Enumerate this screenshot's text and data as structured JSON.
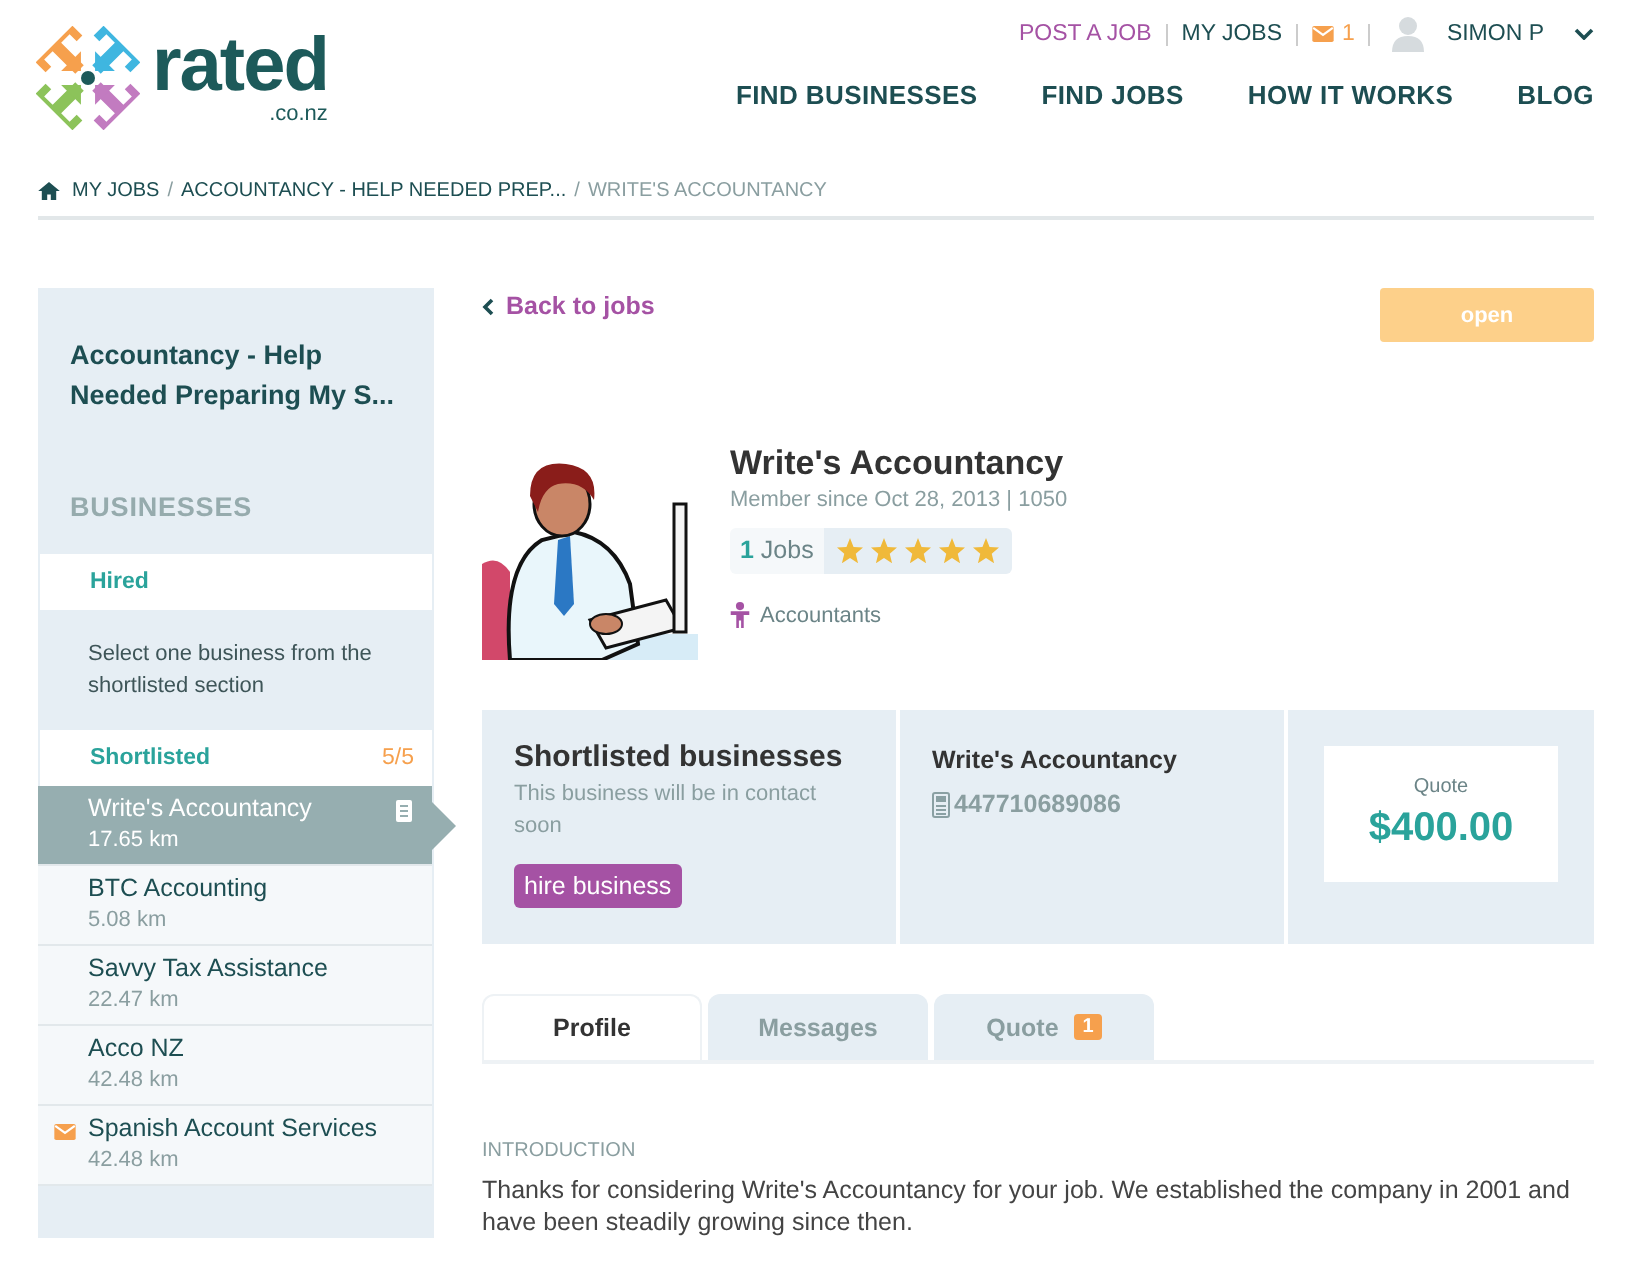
{
  "header": {
    "logo_text": "rated",
    "logo_domain": ".co.nz",
    "top_links": [
      {
        "label": "POST A JOB",
        "kind": "highlight"
      },
      {
        "label": "MY JOBS",
        "kind": "plain"
      }
    ],
    "messages_count": "1",
    "user_name": "SIMON P",
    "nav": [
      "FIND BUSINESSES",
      "FIND JOBS",
      "HOW IT WORKS",
      "BLOG"
    ]
  },
  "breadcrumb": [
    {
      "label": "MY JOBS",
      "current": false
    },
    {
      "separator": "/",
      "label": "ACCOUNTANCY - HELP NEEDED PREP...",
      "current": false
    },
    {
      "separator": "/",
      "label": "WRITE'S ACCOUNTANCY",
      "current": true
    }
  ],
  "sidebar": {
    "job_title": "Accountancy - Help Needed Preparing My S...",
    "section_title": "BUSINESSES",
    "hired_label": "Hired",
    "hired_hint": "Select one business from the shortlisted section",
    "shortlisted_label": "Shortlisted",
    "shortlisted_count": "5/5",
    "businesses": [
      {
        "name": "Write's Accountancy",
        "distance": "17.65 km",
        "selected": true,
        "unread": false
      },
      {
        "name": "BTC Accounting",
        "distance": "5.08 km",
        "selected": false,
        "unread": false
      },
      {
        "name": "Savvy Tax Assistance",
        "distance": "22.47 km",
        "selected": false,
        "unread": false
      },
      {
        "name": "Acco NZ",
        "distance": "42.48 km",
        "selected": false,
        "unread": false
      },
      {
        "name": "Spanish Account Services",
        "distance": "42.48 km",
        "selected": false,
        "unread": true
      }
    ]
  },
  "main": {
    "back_link": "Back to jobs",
    "status": "open",
    "profile": {
      "name": "Write's Accountancy",
      "member_since": "Member since Oct 28, 2013 | 1050",
      "jobs_count": "1",
      "jobs_label": "Jobs",
      "stars": 5,
      "category": "Accountants"
    },
    "status_panel": {
      "title": "Shortlisted businesses",
      "subtitle": "This business will be in contact soon",
      "action": "hire business",
      "business_name": "Write's Accountancy",
      "phone": "447710689086",
      "quote_label": "Quote",
      "quote_amount": "$400.00"
    },
    "tabs": [
      {
        "label": "Profile",
        "selected": true
      },
      {
        "label": "Messages",
        "selected": false
      },
      {
        "label": "Quote",
        "selected": false,
        "badge": "1"
      }
    ],
    "introduction_label": "INTRODUCTION",
    "introduction": "Thanks for considering Write's Accountancy for your job. We established the company in 2001 and have been steadily growing since then."
  }
}
